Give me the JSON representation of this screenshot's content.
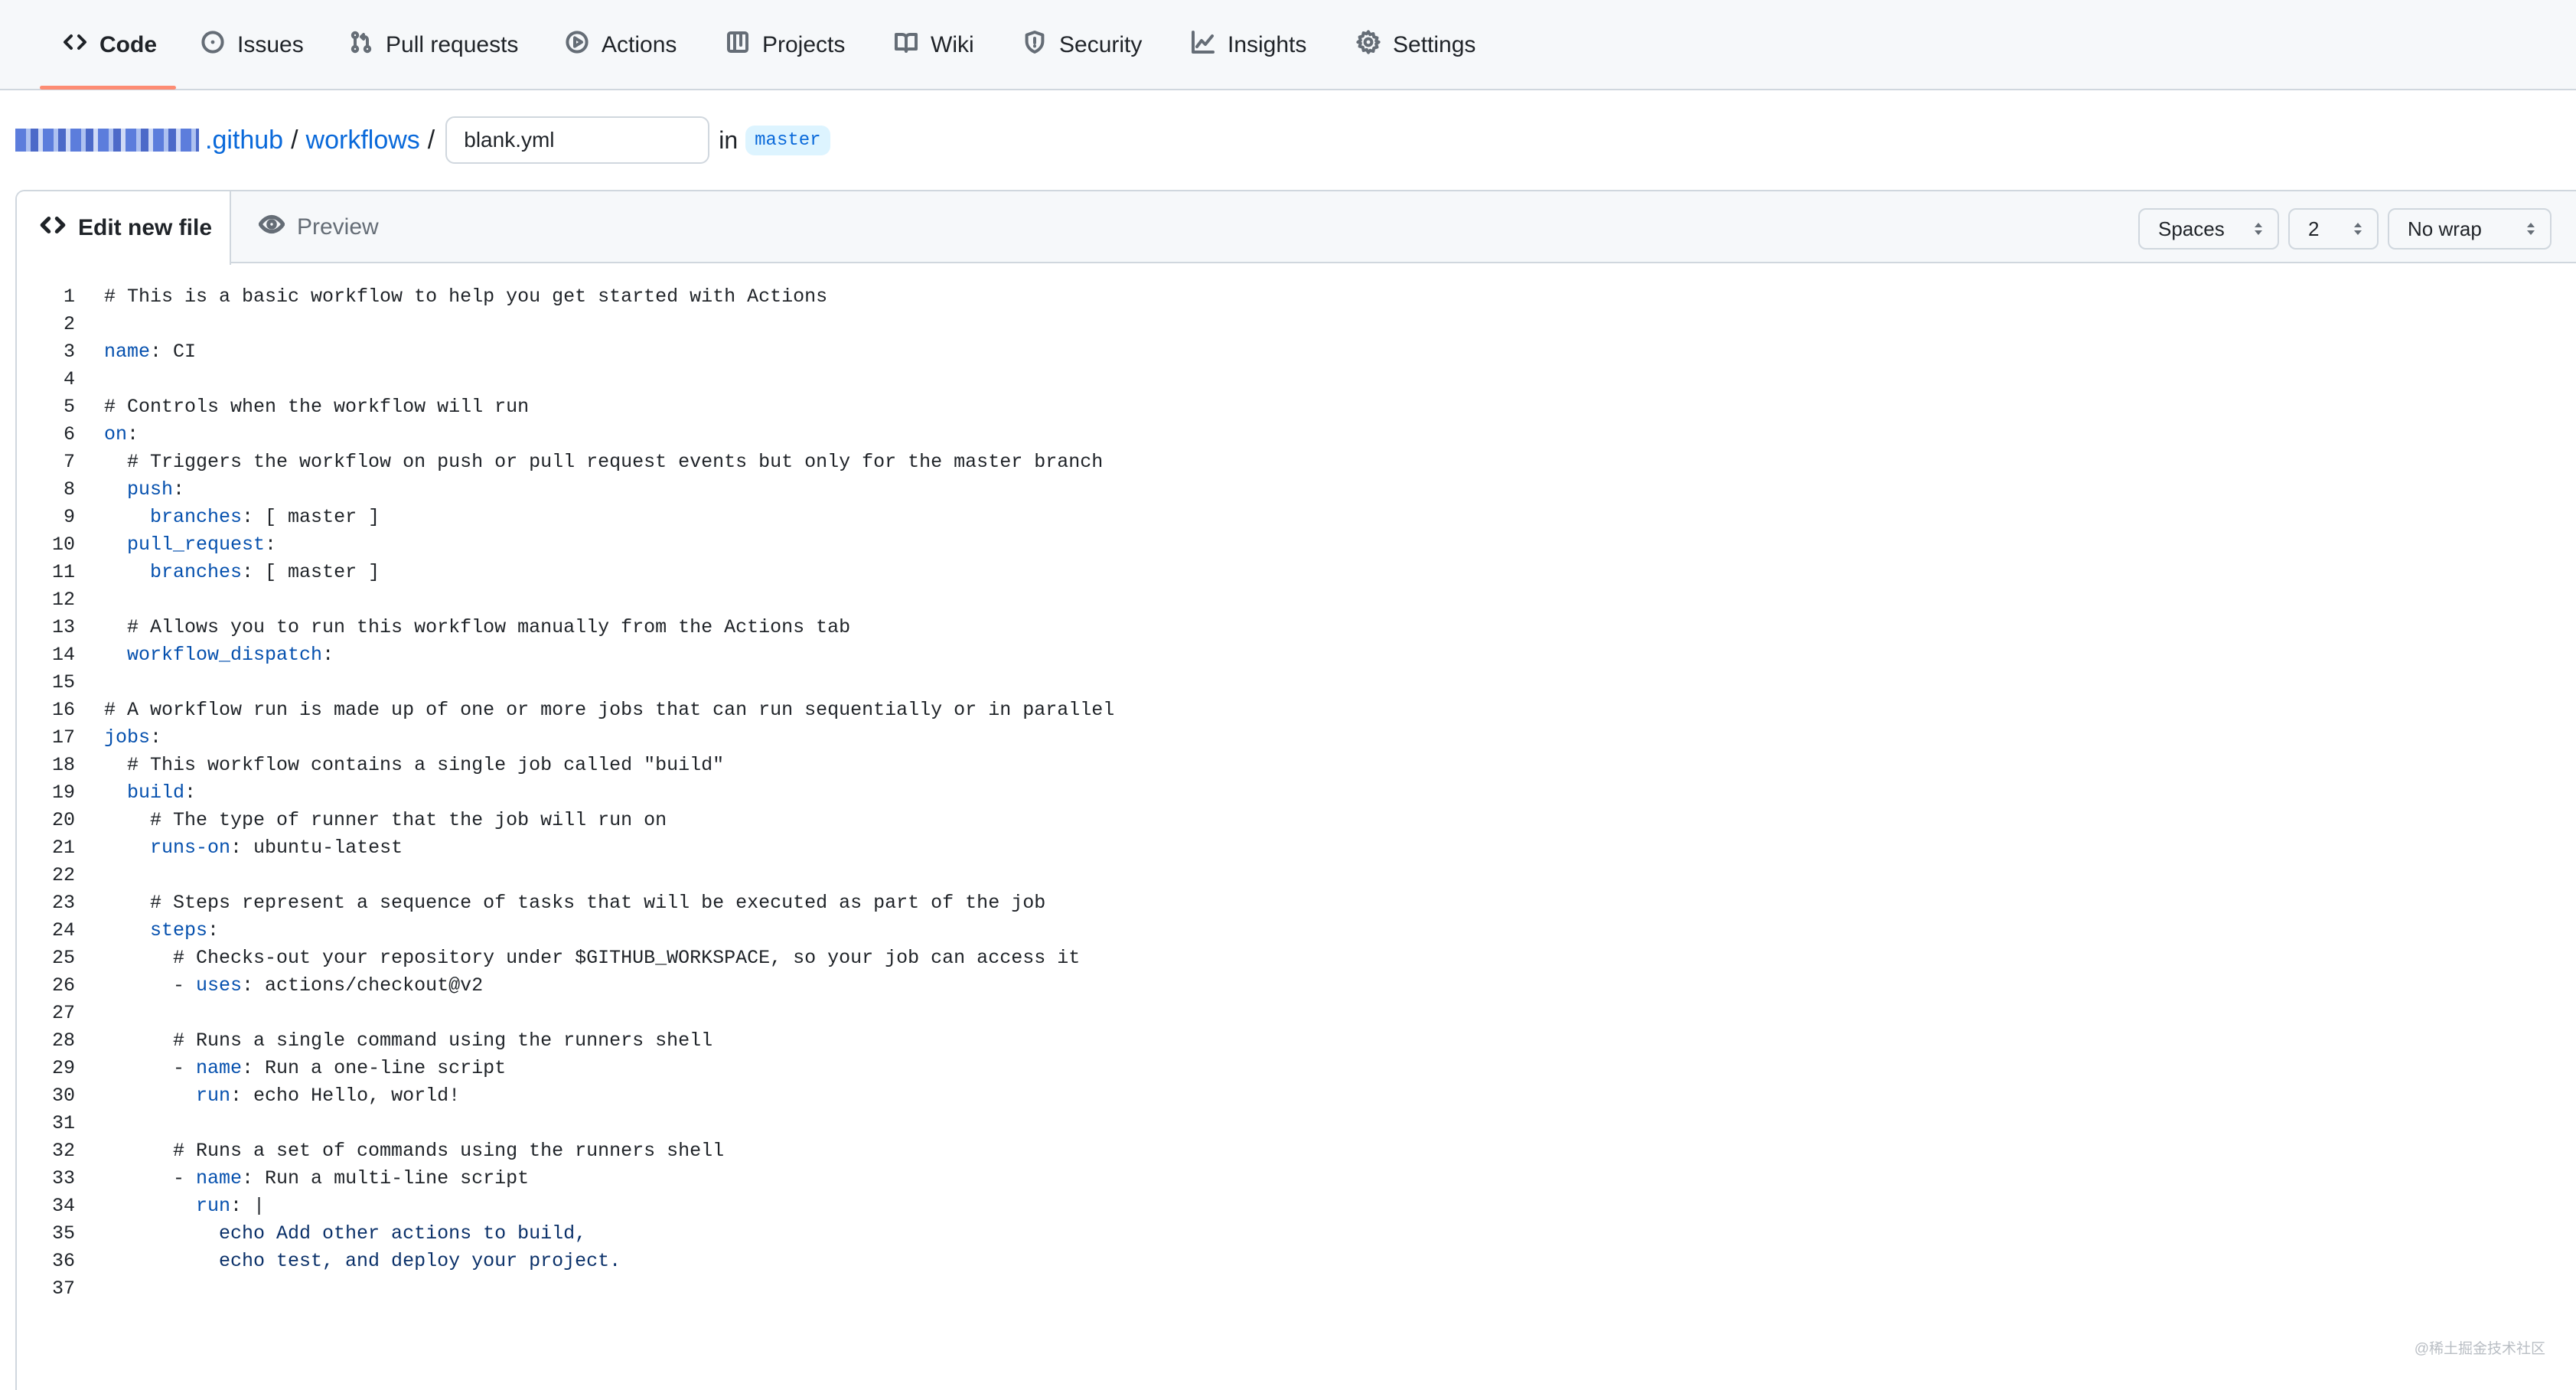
{
  "nav": {
    "tabs": [
      {
        "id": "code",
        "label": "Code",
        "icon": "code-icon",
        "selected": true
      },
      {
        "id": "issues",
        "label": "Issues",
        "icon": "issue-opened-icon"
      },
      {
        "id": "pull-requests",
        "label": "Pull requests",
        "icon": "git-pull-request-icon"
      },
      {
        "id": "actions",
        "label": "Actions",
        "icon": "play-icon"
      },
      {
        "id": "projects",
        "label": "Projects",
        "icon": "table-icon"
      },
      {
        "id": "wiki",
        "label": "Wiki",
        "icon": "book-icon"
      },
      {
        "id": "security",
        "label": "Security",
        "icon": "shield-icon"
      },
      {
        "id": "insights",
        "label": "Insights",
        "icon": "graph-icon"
      },
      {
        "id": "settings",
        "label": "Settings",
        "icon": "gear-icon"
      }
    ],
    "accent_color": "#fd8c73"
  },
  "breadcrumb": {
    "dir1": ".github",
    "sep": "/",
    "dir2": "workflows",
    "filename": "blank.yml",
    "in_label": "in",
    "branch": "master"
  },
  "editor": {
    "tab_edit": "Edit new file",
    "tab_preview": "Preview",
    "indent_mode": "Spaces",
    "indent_size": "2",
    "wrap_mode": "No wrap",
    "lines": [
      "# This is a basic workflow to help you get started with Actions",
      "",
      "name: CI",
      "",
      "# Controls when the workflow will run",
      "on:",
      "  # Triggers the workflow on push or pull request events but only for the master branch",
      "  push:",
      "    branches: [ master ]",
      "  pull_request:",
      "    branches: [ master ]",
      "",
      "  # Allows you to run this workflow manually from the Actions tab",
      "  workflow_dispatch:",
      "",
      "# A workflow run is made up of one or more jobs that can run sequentially or in parallel",
      "jobs:",
      "  # This workflow contains a single job called \"build\"",
      "  build:",
      "    # The type of runner that the job will run on",
      "    runs-on: ubuntu-latest",
      "",
      "    # Steps represent a sequence of tasks that will be executed as part of the job",
      "    steps:",
      "      # Checks-out your repository under $GITHUB_WORKSPACE, so your job can access it",
      "      - uses: actions/checkout@v2",
      "",
      "      # Runs a single command using the runners shell",
      "      - name: Run a one-line script",
      "        run: echo Hello, world!",
      "",
      "      # Runs a set of commands using the runners shell",
      "      - name: Run a multi-line script",
      "        run: |",
      "          echo Add other actions to build,",
      "          echo test, and deploy your project.",
      ""
    ]
  },
  "watermark": "@稀土掘金技术社区"
}
